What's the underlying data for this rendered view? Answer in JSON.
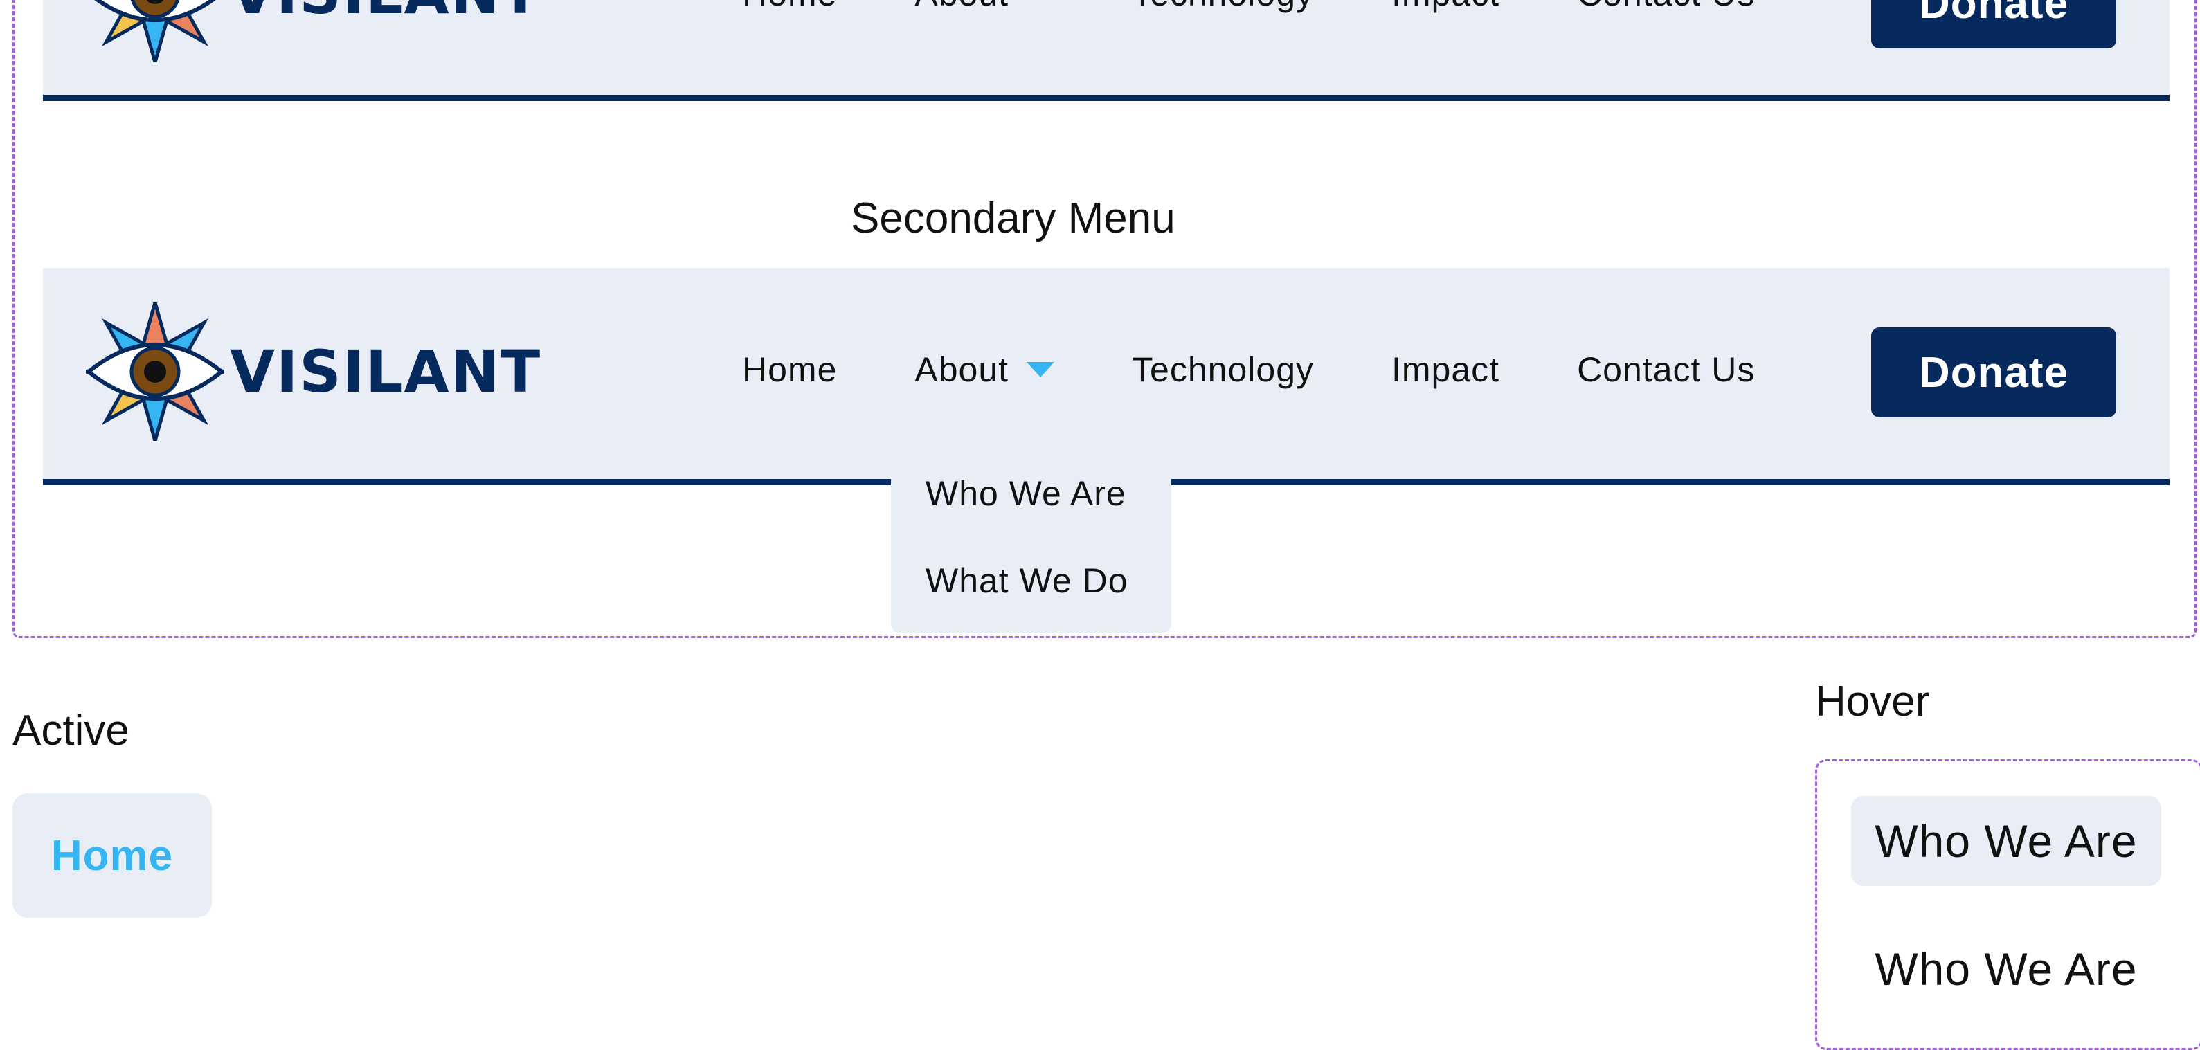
{
  "brand": {
    "name": "VISILANT",
    "navy": "#062a5e",
    "accent": "#35b5f2",
    "nav_bg": "#e9eef6",
    "frame_color": "#a45ee5"
  },
  "top_nav": {
    "items": [
      "Home",
      "About",
      "Technology",
      "Impact",
      "Contact Us"
    ],
    "donate_label": "Donate"
  },
  "secondary": {
    "title": "Secondary Menu",
    "nav": {
      "items": [
        "Home",
        "About",
        "Technology",
        "Impact",
        "Contact Us"
      ],
      "donate_label": "Donate"
    },
    "dropdown": [
      "Who We Are",
      "What We Do"
    ]
  },
  "active_state": {
    "title": "Active",
    "label": "Home"
  },
  "hover_state": {
    "title": "Hover",
    "items": [
      "Who We Are",
      "Who We Are"
    ]
  }
}
